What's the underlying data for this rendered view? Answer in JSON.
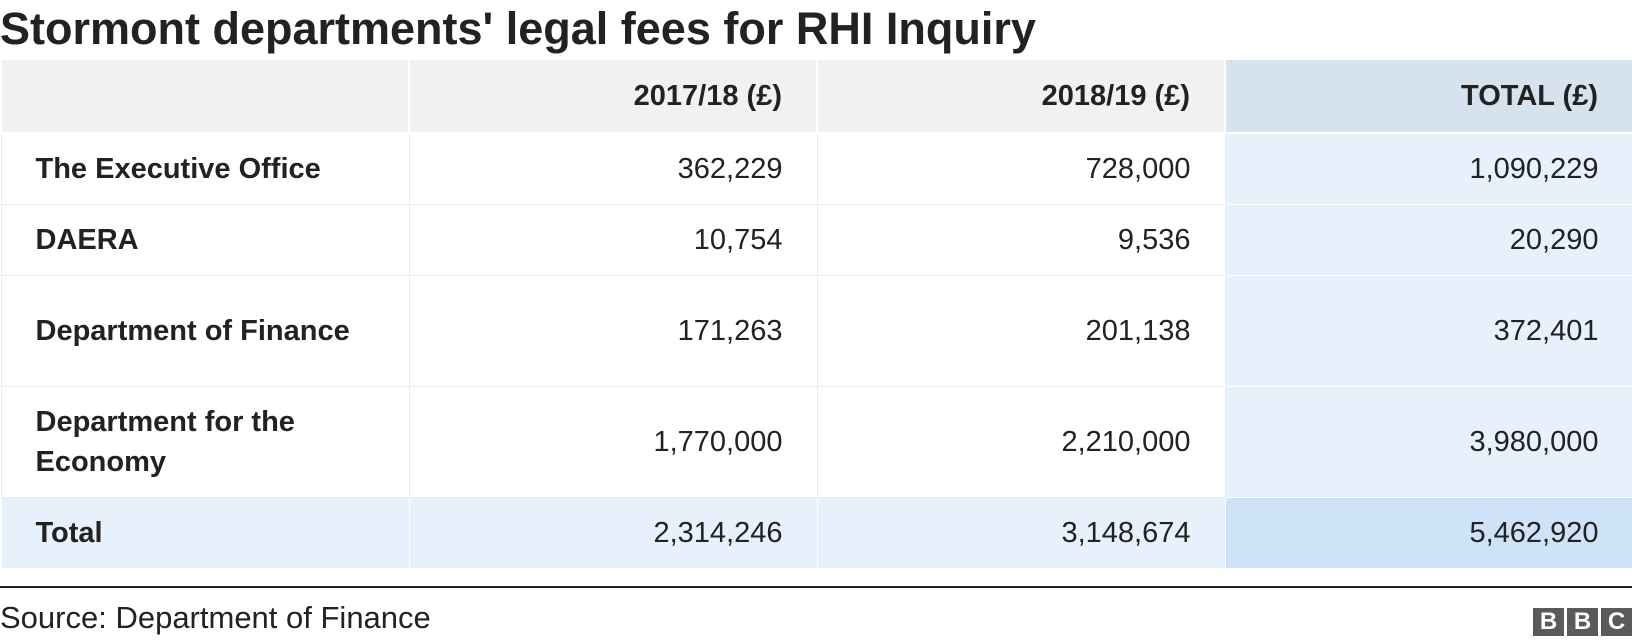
{
  "title": "Stormont departments' legal fees for RHI Inquiry",
  "chart_data": {
    "type": "table",
    "title": "Stormont departments' legal fees for RHI Inquiry",
    "columns": [
      "",
      "2017/18 (£)",
      "2018/19 (£)",
      "TOTAL (£)"
    ],
    "rows": [
      [
        "The Executive Office",
        "362,229",
        "728,000",
        "1,090,229"
      ],
      [
        "DAERA",
        "10,754",
        "9,536",
        "20,290"
      ],
      [
        "Department of Finance",
        "171,263",
        "201,138",
        "372,401"
      ],
      [
        "Department for the Economy",
        "1,770,000",
        "2,210,000",
        "3,980,000"
      ],
      [
        "Total",
        "2,314,246",
        "3,148,674",
        "5,462,920"
      ]
    ]
  },
  "source": "Source: Department of Finance",
  "logo": {
    "letters": [
      "B",
      "B",
      "C"
    ]
  },
  "colors": {
    "header_bg": "#f1f1f1",
    "total_header_bg": "#d6e3ef",
    "total_col_bg": "#e6f1fb",
    "grand_total_bg": "#cfe3f8",
    "text": "#222222"
  }
}
